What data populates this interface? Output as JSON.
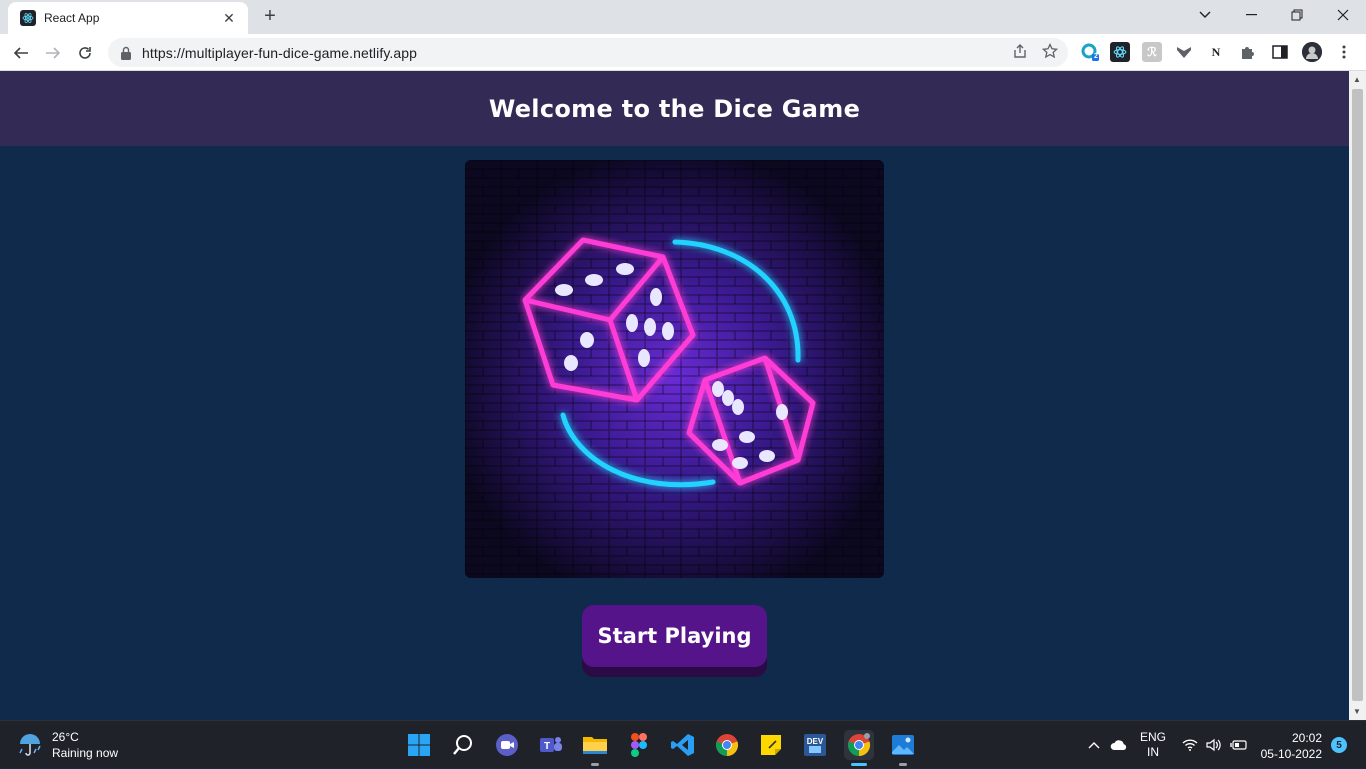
{
  "browser": {
    "tab_title": "React App",
    "url": "https://multiplayer-fun-dice-game.netlify.app",
    "extension_badge": "2",
    "accent": "#dee1e6"
  },
  "page": {
    "header_title": "Welcome to the Dice Game",
    "hero_alt": "neon dice illustration",
    "start_button": "Start Playing",
    "colors": {
      "header_bg": "#332a55",
      "page_bg": "#0f2a4a",
      "button_bg": "#55148a",
      "button_shadow": "#2a0b46",
      "neon_pink": "#ff3dd6",
      "neon_cyan": "#22d3ff"
    }
  },
  "taskbar": {
    "weather_temp": "26°C",
    "weather_desc": "Raining now",
    "lang_line1": "ENG",
    "lang_line2": "IN",
    "time": "20:02",
    "date": "05-10-2022",
    "notification_count": "5",
    "apps": [
      "start",
      "search",
      "meet",
      "teams",
      "file-explorer",
      "figma",
      "vscode",
      "chrome",
      "sticky-notes",
      "devtoys",
      "chrome-canary",
      "photos"
    ]
  }
}
